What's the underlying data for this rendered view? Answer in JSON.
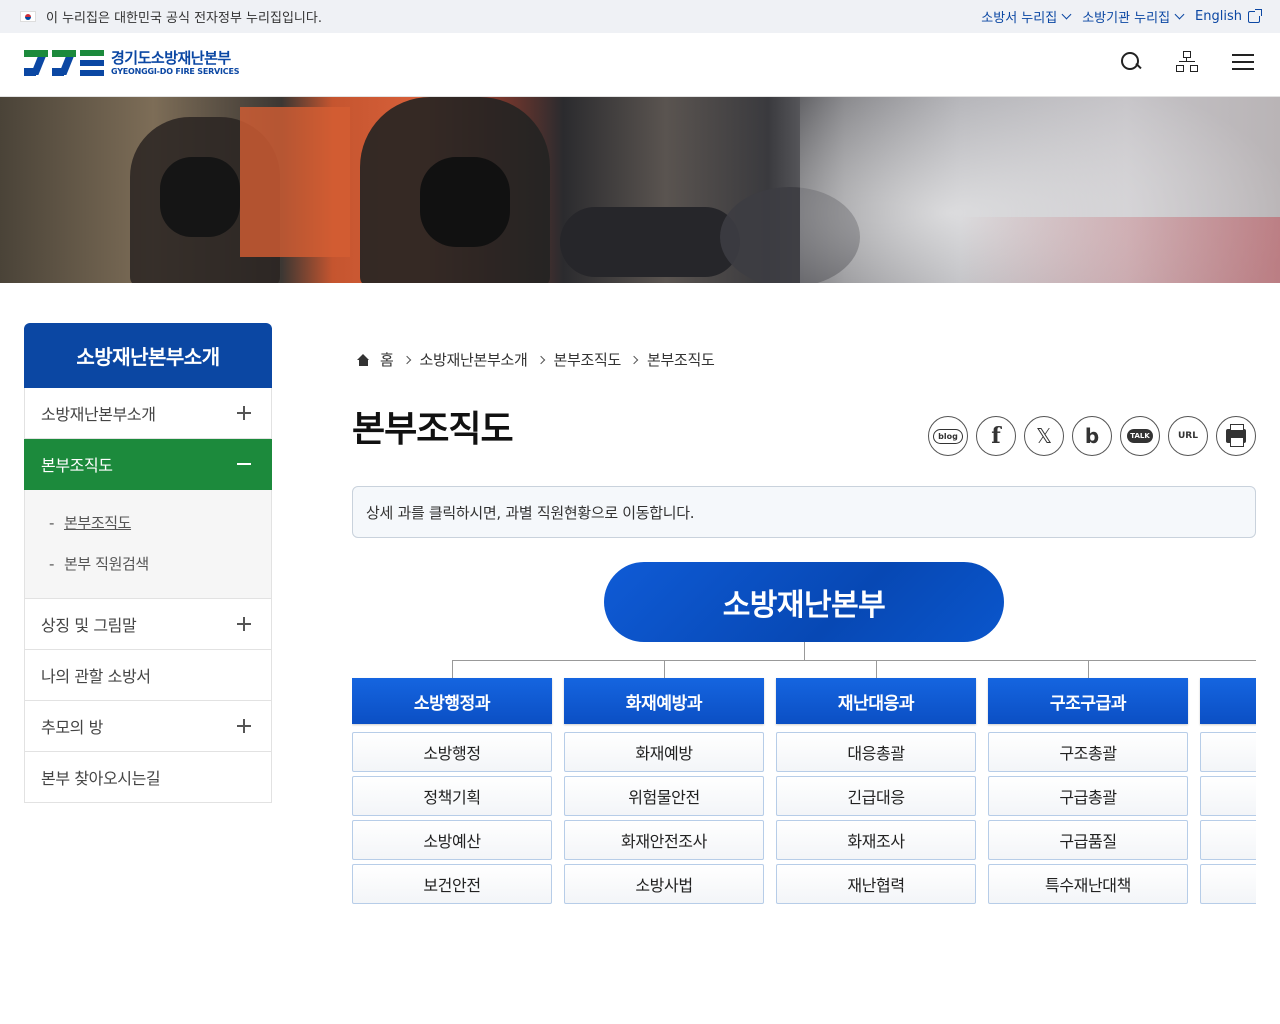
{
  "gov_bar": {
    "notice": "이 누리집은 대한민국 공식 전자정부 누리집입니다.",
    "links": [
      "소방서 누리집",
      "소방기관 누리집",
      "English"
    ]
  },
  "header": {
    "logo_ko": "경기도소방재난본부",
    "logo_en": "GYEONGGI-DO FIRE SERVICES",
    "icons": [
      "search-icon",
      "sitemap-icon",
      "menu-icon"
    ]
  },
  "sidebar": {
    "title": "소방재난본부소개",
    "items": [
      {
        "label": "소방재난본부소개",
        "expand": "plus"
      },
      {
        "label": "본부조직도",
        "expand": "minus",
        "active": true
      },
      {
        "label": "상징 및 그림말",
        "expand": "plus"
      },
      {
        "label": "나의 관할 소방서",
        "expand": ""
      },
      {
        "label": "추모의 방",
        "expand": "plus"
      },
      {
        "label": "본부 찾아오시는길",
        "expand": ""
      }
    ],
    "sub_items": [
      "본부조직도",
      "본부 직원검색"
    ]
  },
  "breadcrumb": [
    "홈",
    "소방재난본부소개",
    "본부조직도",
    "본부조직도"
  ],
  "page_title": "본부조직도",
  "share": {
    "icons": [
      "blog-icon",
      "facebook-icon",
      "x-icon",
      "band-icon",
      "kakaotalk-icon",
      "url-copy-icon",
      "print-icon"
    ],
    "blog_label": "blog",
    "fb_label": "f",
    "x_label": "𝕏",
    "band_label": "b",
    "talk_label": "TALK",
    "url_label": "URL"
  },
  "notice": "상세 과를 클릭하시면, 과별 직원현황으로 이동합니다.",
  "org": {
    "root": "소방재난본부",
    "depts": [
      {
        "name": "소방행정과",
        "teams": [
          "소방행정",
          "정책기획",
          "소방예산",
          "보건안전"
        ]
      },
      {
        "name": "화재예방과",
        "teams": [
          "화재예방",
          "위험물안전",
          "화재안전조사",
          "소방사법"
        ]
      },
      {
        "name": "재난대응과",
        "teams": [
          "대응총괄",
          "긴급대응",
          "화재조사",
          "재난협력"
        ]
      },
      {
        "name": "구조구급과",
        "teams": [
          "구조총괄",
          "구급총괄",
          "구급품질",
          "특수재난대책"
        ]
      },
      {
        "name": "",
        "teams": [
          "",
          "",
          "",
          ""
        ]
      }
    ]
  },
  "colors": {
    "brand_blue": "#0b47a3",
    "active_green": "#1c8a3c",
    "dept_blue": "#0b4fc4"
  }
}
